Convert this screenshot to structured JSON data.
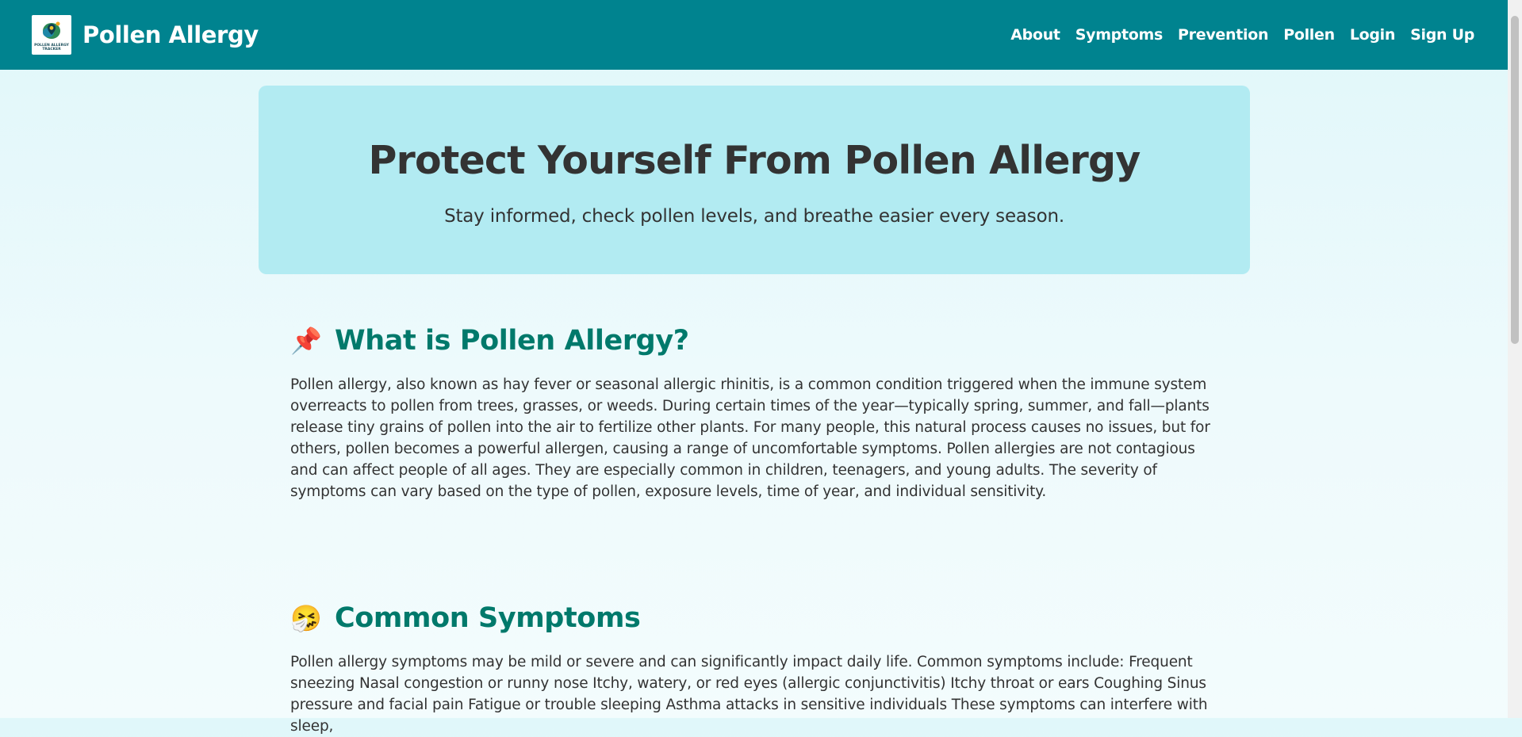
{
  "header": {
    "logo_lines": [
      "POLLEN ALLERGY",
      "TRACKER"
    ],
    "brand": "Pollen Allergy",
    "nav": [
      "About",
      "Symptoms",
      "Prevention",
      "Pollen",
      "Login",
      "Sign Up"
    ]
  },
  "hero": {
    "title": "Protect Yourself From Pollen Allergy",
    "subtitle": "Stay informed, check pollen levels, and breathe easier every season."
  },
  "sections": [
    {
      "icon": "📌",
      "icon_name": "pushpin-icon",
      "title": "What is Pollen Allergy?",
      "body": "Pollen allergy, also known as hay fever or seasonal allergic rhinitis, is a common condition triggered when the immune system overreacts to pollen from trees, grasses, or weeds. During certain times of the year—typically spring, summer, and fall—plants release tiny grains of pollen into the air to fertilize other plants. For many people, this natural process causes no issues, but for others, pollen becomes a powerful allergen, causing a range of uncomfortable symptoms. Pollen allergies are not contagious and can affect people of all ages. They are especially common in children, teenagers, and young adults. The severity of symptoms can vary based on the type of pollen, exposure levels, time of year, and individual sensitivity."
    },
    {
      "icon": "🤧",
      "icon_name": "sneezing-face-icon",
      "title": "Common Symptoms",
      "body": "Pollen allergy symptoms may be mild or severe and can significantly impact daily life. Common symptoms include: Frequent sneezing Nasal congestion or runny nose Itchy, watery, or red eyes (allergic conjunctivitis) Itchy throat or ears Coughing Sinus pressure and facial pain Fatigue or trouble sleeping Asthma attacks in sensitive individuals These symptoms can interfere with sleep,"
    }
  ],
  "colors": {
    "navbar": "#00838f",
    "hero_bg": "#b2ebf2",
    "heading": "#00796b",
    "page_bg": "#e0f7fa"
  }
}
